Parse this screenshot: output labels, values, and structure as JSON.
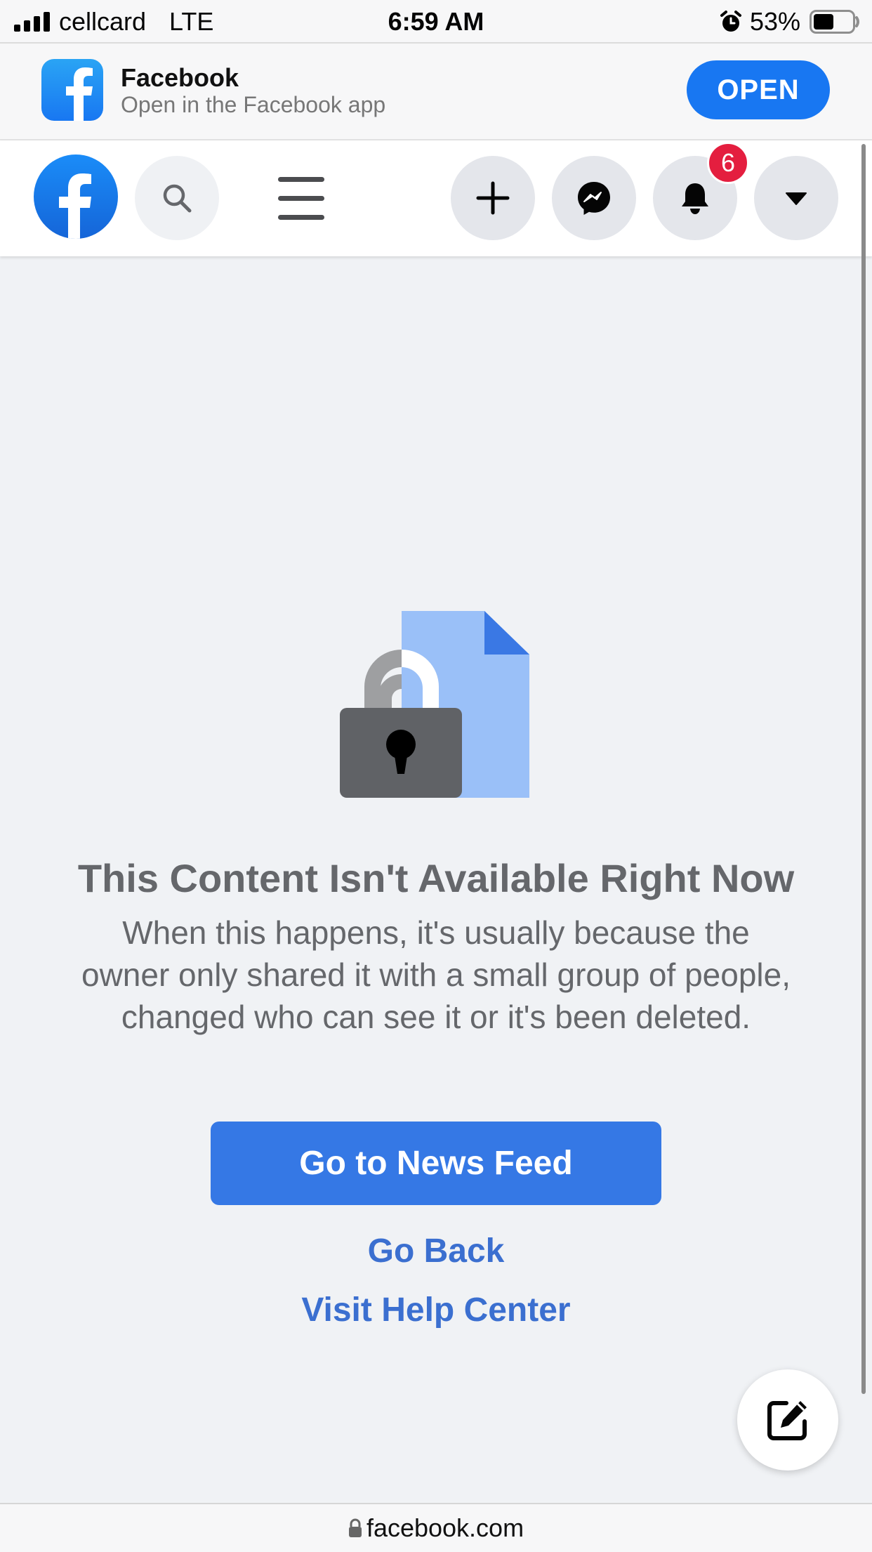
{
  "status_bar": {
    "carrier": "cellcard",
    "network": "LTE",
    "time": "6:59 AM",
    "battery_percent": "53%",
    "battery_level": 0.53,
    "icons": [
      "signal-icon",
      "alarm-icon",
      "battery-icon"
    ]
  },
  "app_banner": {
    "app_name": "Facebook",
    "subtitle": "Open in the Facebook app",
    "open_label": "OPEN",
    "icon": "facebook-app-icon"
  },
  "nav": {
    "icons": [
      "facebook-logo-icon",
      "search-icon",
      "hamburger-menu-icon",
      "plus-icon",
      "messenger-icon",
      "bell-icon",
      "caret-down-icon"
    ],
    "notification_count": "6"
  },
  "content": {
    "illustration": "locked-document-icon",
    "headline": "This Content Isn't Available Right Now",
    "message": "When this happens, it's usually because the owner only shared it with a small group of people, changed who can see it or it's been deleted.",
    "primary_button": "Go to News Feed",
    "go_back": "Go Back",
    "help_center": "Visit Help Center",
    "fab_icon": "compose-icon"
  },
  "url_bar": {
    "domain": "facebook.com",
    "icon": "lock-icon"
  },
  "colors": {
    "facebook_blue": "#1877f2",
    "button_blue": "#3578e5",
    "link_blue": "#3b6fd0",
    "badge_red": "#e41e3f",
    "background": "#f0f2f5",
    "muted_text": "#65676b"
  }
}
